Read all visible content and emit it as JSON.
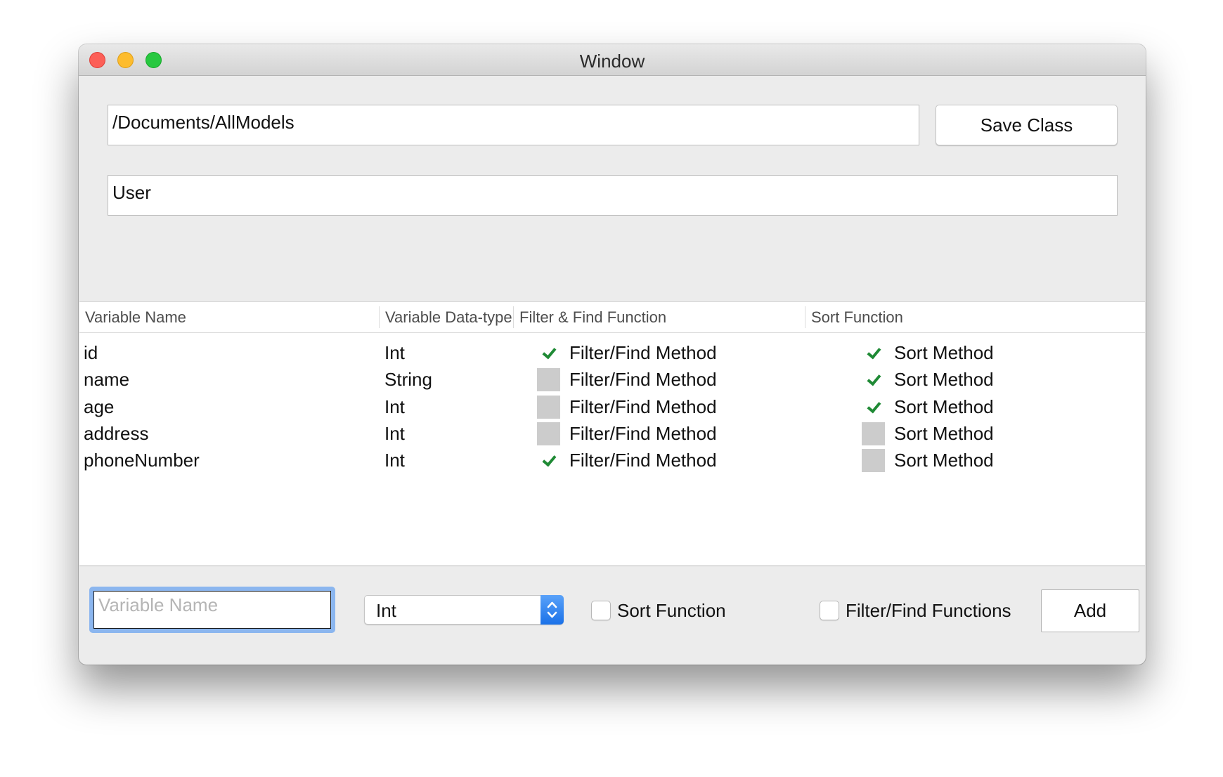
{
  "window": {
    "title": "Window"
  },
  "path_field": {
    "value": "/Documents/AllModels"
  },
  "class_field": {
    "value": "User"
  },
  "save_class_button": {
    "label": "Save Class"
  },
  "table": {
    "columns": [
      "Variable Name",
      "Variable Data-type",
      "Filter & Find Function",
      "Sort Function"
    ],
    "rows": [
      {
        "name": "id",
        "type": "Int",
        "filter_checked": true,
        "filter_label": "Filter/Find Method",
        "sort_checked": true,
        "sort_label": "Sort Method"
      },
      {
        "name": "name",
        "type": "String",
        "filter_checked": false,
        "filter_label": "Filter/Find Method",
        "sort_checked": true,
        "sort_label": "Sort Method"
      },
      {
        "name": "age",
        "type": "Int",
        "filter_checked": false,
        "filter_label": "Filter/Find Method",
        "sort_checked": true,
        "sort_label": "Sort Method"
      },
      {
        "name": "address",
        "type": "Int",
        "filter_checked": false,
        "filter_label": "Filter/Find Method",
        "sort_checked": false,
        "sort_label": "Sort Method"
      },
      {
        "name": "phoneNumber",
        "type": "Int",
        "filter_checked": true,
        "filter_label": "Filter/Find Method",
        "sort_checked": false,
        "sort_label": "Sort Method"
      }
    ]
  },
  "bottom_bar": {
    "variable_name_placeholder": "Variable Name",
    "variable_name_value": "",
    "type_popup_value": "Int",
    "sort_checkbox_label": "Sort Function",
    "sort_checkbox_checked": false,
    "filter_checkbox_label": "Filter/Find Functions",
    "filter_checkbox_checked": false,
    "add_button_label": "Add"
  },
  "colors": {
    "check_green": "#1f8a35",
    "focus_ring": "#8bb6ef",
    "popup_accent": "#1a71e8"
  },
  "icons": {
    "close": "close-icon",
    "minimize": "minimize-icon",
    "zoom": "zoom-icon",
    "checkmark": "checkmark-icon",
    "stepper": "up-down-chevron-icon"
  }
}
